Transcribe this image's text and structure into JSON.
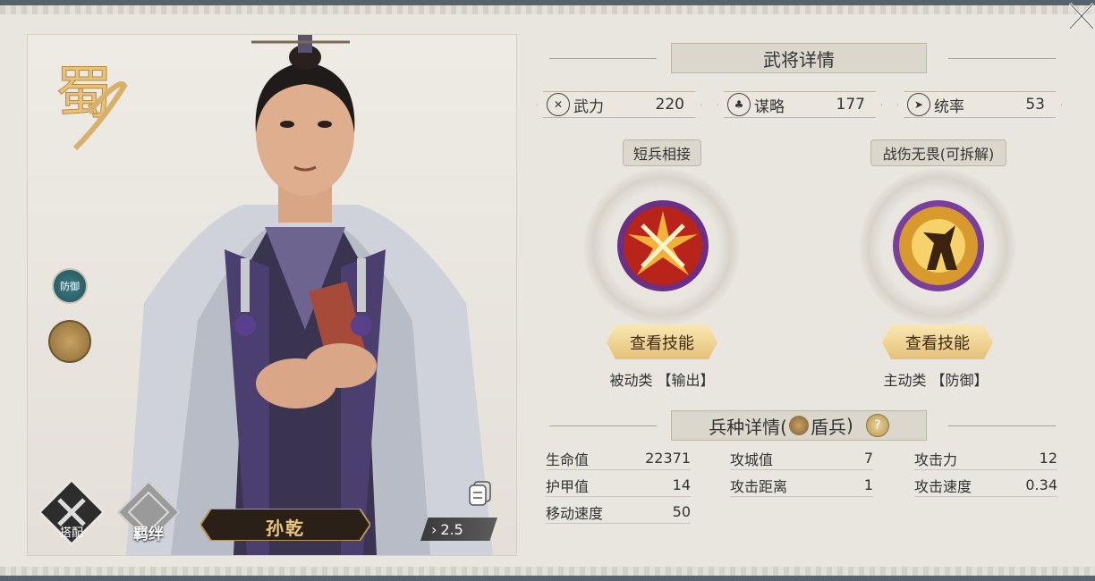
{
  "general": {
    "kingdom_glyph": "蜀",
    "name": "孙乾",
    "cost": "2.5",
    "defense_badge": "防御",
    "equip_label": "搭配",
    "bond_label": "羁绊"
  },
  "details": {
    "title": "武将详情",
    "stats": [
      {
        "label": "武力",
        "value": "220",
        "icon": "crossed-swords-icon"
      },
      {
        "label": "谋略",
        "value": "177",
        "icon": "strategy-icon"
      },
      {
        "label": "统率",
        "value": "53",
        "icon": "command-flag-icon"
      }
    ],
    "skills": [
      {
        "name": "短兵相接",
        "button": "查看技能",
        "type": "被动类",
        "tag": "【输出】"
      },
      {
        "name": "战伤无畏(可拆解)",
        "button": "查看技能",
        "type": "主动类",
        "tag": "【防御】"
      }
    ]
  },
  "troop": {
    "title_prefix": "兵种详情(",
    "troop_name": "盾兵",
    "title_suffix": ")",
    "help": "?",
    "rows": [
      [
        {
          "k": "生命值",
          "v": "22371"
        },
        {
          "k": "攻城值",
          "v": "7"
        },
        {
          "k": "攻击力",
          "v": "12"
        }
      ],
      [
        {
          "k": "护甲值",
          "v": "14"
        },
        {
          "k": "攻击距离",
          "v": "1"
        },
        {
          "k": "攻击速度",
          "v": "0.34"
        }
      ],
      [
        {
          "k": "移动速度",
          "v": "50"
        }
      ]
    ]
  },
  "colors": {
    "accent_gold": "#e6c17a",
    "panel_bg": "#e9e6e0",
    "frame": "#56626d"
  }
}
